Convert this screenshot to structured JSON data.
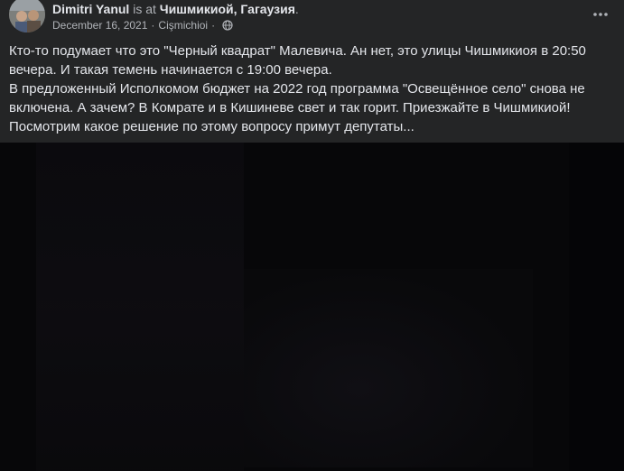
{
  "post": {
    "author": "Dimitri Yanul",
    "connector": " is at ",
    "location": "Чишмикиой, Гагаузия",
    "location_suffix": ".",
    "date": "December 16, 2021",
    "separator": "·",
    "place": "Cişmichioi",
    "privacy_icon": "globe-icon",
    "more_icon": "more-options-icon",
    "text": "Кто-то подумает что это \"Черный квадрат\" Малевича. Ан нет, это улицы Чишмикиоя в 20:50 вечера. И такая темень начинается с 19:00 вечера.\nВ предложенный Исполкомом бюджет на 2022 год программа \"Освещённое село\" снова не включена. А зачем? В Комрате и в Кишиневе свет и так горит. Приезжайте в Чишмикиой! Посмотрим какое решение по этому вопросу примут депутаты..."
  },
  "colors": {
    "background": "#242526",
    "text_primary": "#e4e6eb",
    "text_secondary": "#b0b3b8",
    "photo_background": "#070709"
  }
}
